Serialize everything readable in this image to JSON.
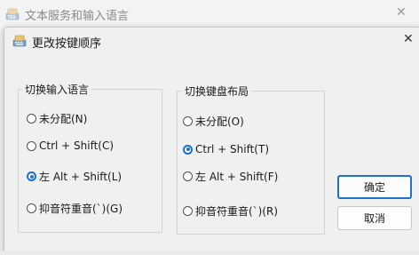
{
  "background_window": {
    "title": "文本服务和输入语言",
    "close_glyph": "✕"
  },
  "dialog": {
    "title": "更改按键顺序",
    "close_glyph": "✕"
  },
  "left_group": {
    "label": "切换输入语言",
    "options": [
      {
        "label": "未分配(N)",
        "checked": false
      },
      {
        "label": "Ctrl + Shift(C)",
        "checked": false
      },
      {
        "label": "左 Alt + Shift(L)",
        "checked": true
      },
      {
        "label": "抑音符重音(`)(G)",
        "checked": false
      }
    ]
  },
  "right_group": {
    "label": "切换键盘布局",
    "options": [
      {
        "label": "未分配(O)",
        "checked": false
      },
      {
        "label": "Ctrl + Shift(T)",
        "checked": true
      },
      {
        "label": "左 Alt + Shift(F)",
        "checked": false
      },
      {
        "label": "抑音符重音(`)(R)",
        "checked": false
      }
    ]
  },
  "buttons": {
    "ok": "确定",
    "cancel": "取消"
  },
  "colors": {
    "accent": "#1f6fd1",
    "dialog_bg": "#f0f0f0"
  },
  "icons": {
    "app": "keyboard-app-icon"
  }
}
